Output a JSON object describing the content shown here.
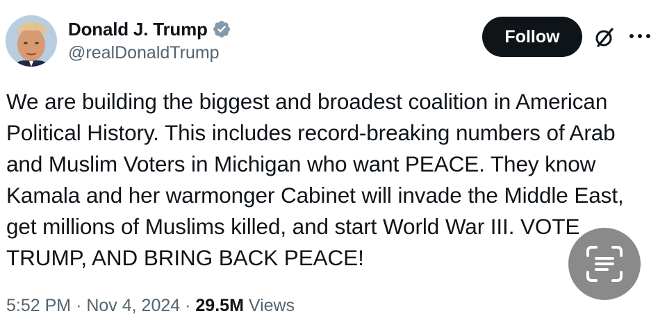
{
  "author": {
    "display_name": "Donald J. Trump",
    "handle": "@realDonaldTrump",
    "verified": true,
    "avatar_icon": "profile-photo"
  },
  "header": {
    "follow_label": "Follow",
    "grok_icon": "grok-slash-circle-icon",
    "more_icon": "more-dots-icon"
  },
  "tweet": {
    "text_lines": [
      "We are building the biggest and broadest coalition in American",
      "Political History. This includes record-breaking numbers of Arab",
      "and Muslim Voters in Michigan who want PEACE. They know",
      "Kamala and her warmonger Cabinet will invade the Middle East,",
      "get millions of Muslims killed, and start World War III. VOTE",
      "TRUMP, AND BRING BACK PEACE!"
    ]
  },
  "meta": {
    "time": "5:52 PM",
    "separator": "·",
    "date": "Nov 4, 2024",
    "views_count": "29.5M",
    "views_label": "Views"
  },
  "overlay": {
    "live_text_icon": "live-text-scan-icon"
  },
  "colors": {
    "text_primary": "#0f1419",
    "text_secondary": "#536471",
    "verified_badge": "#829aab",
    "follow_bg": "#0f1419"
  }
}
